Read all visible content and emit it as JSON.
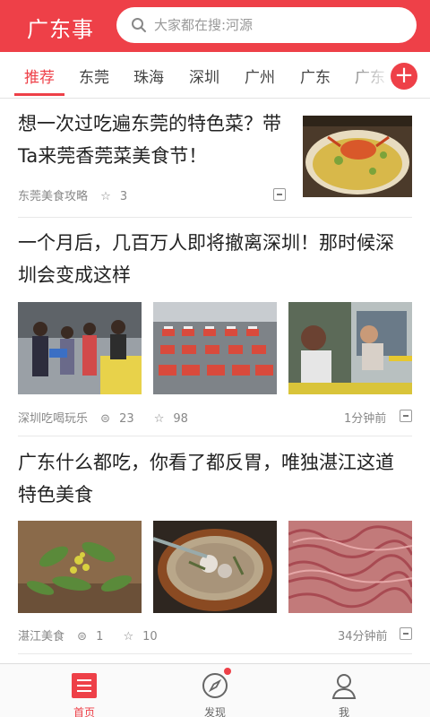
{
  "header": {
    "app_title": "广东事",
    "search_placeholder": "大家都在搜:河源"
  },
  "tabs": [
    "推荐",
    "东莞",
    "珠海",
    "深圳",
    "广州",
    "广东",
    "广东"
  ],
  "active_tab": "推荐",
  "add_tab_label": "+",
  "articles": [
    {
      "title": "想一次过吃遍东莞的特色菜？带Ta来莞香莞菜美食节！",
      "source": "东莞美食攻略",
      "likes": "3",
      "thumbnails": [
        "crab-dish-image"
      ]
    },
    {
      "title": "一个月后，几百万人即将撤离深圳！那时候深圳会变成这样",
      "source": "深圳吃喝玩乐",
      "comments": "23",
      "likes": "98",
      "time": "1分钟前",
      "thumbnails": [
        "crowd-street-image",
        "taxi-queue-image",
        "bus-crowd-image"
      ]
    },
    {
      "title": "广东什么都吃，你看了都反胃，唯独湛江这道特色美食",
      "source": "湛江美食",
      "comments": "1",
      "likes": "10",
      "time": "34分钟前",
      "thumbnails": [
        "green-herb-image",
        "soup-pot-image",
        "worm-dish-image"
      ]
    }
  ],
  "bottom_nav": [
    {
      "label": "首页",
      "icon": "home-list-icon",
      "active": true
    },
    {
      "label": "发现",
      "icon": "compass-icon",
      "active": false,
      "badge": true
    },
    {
      "label": "我",
      "icon": "user-icon",
      "active": false
    }
  ],
  "colors": {
    "accent": "#ee4048",
    "text": "#222222",
    "meta": "#888888"
  }
}
